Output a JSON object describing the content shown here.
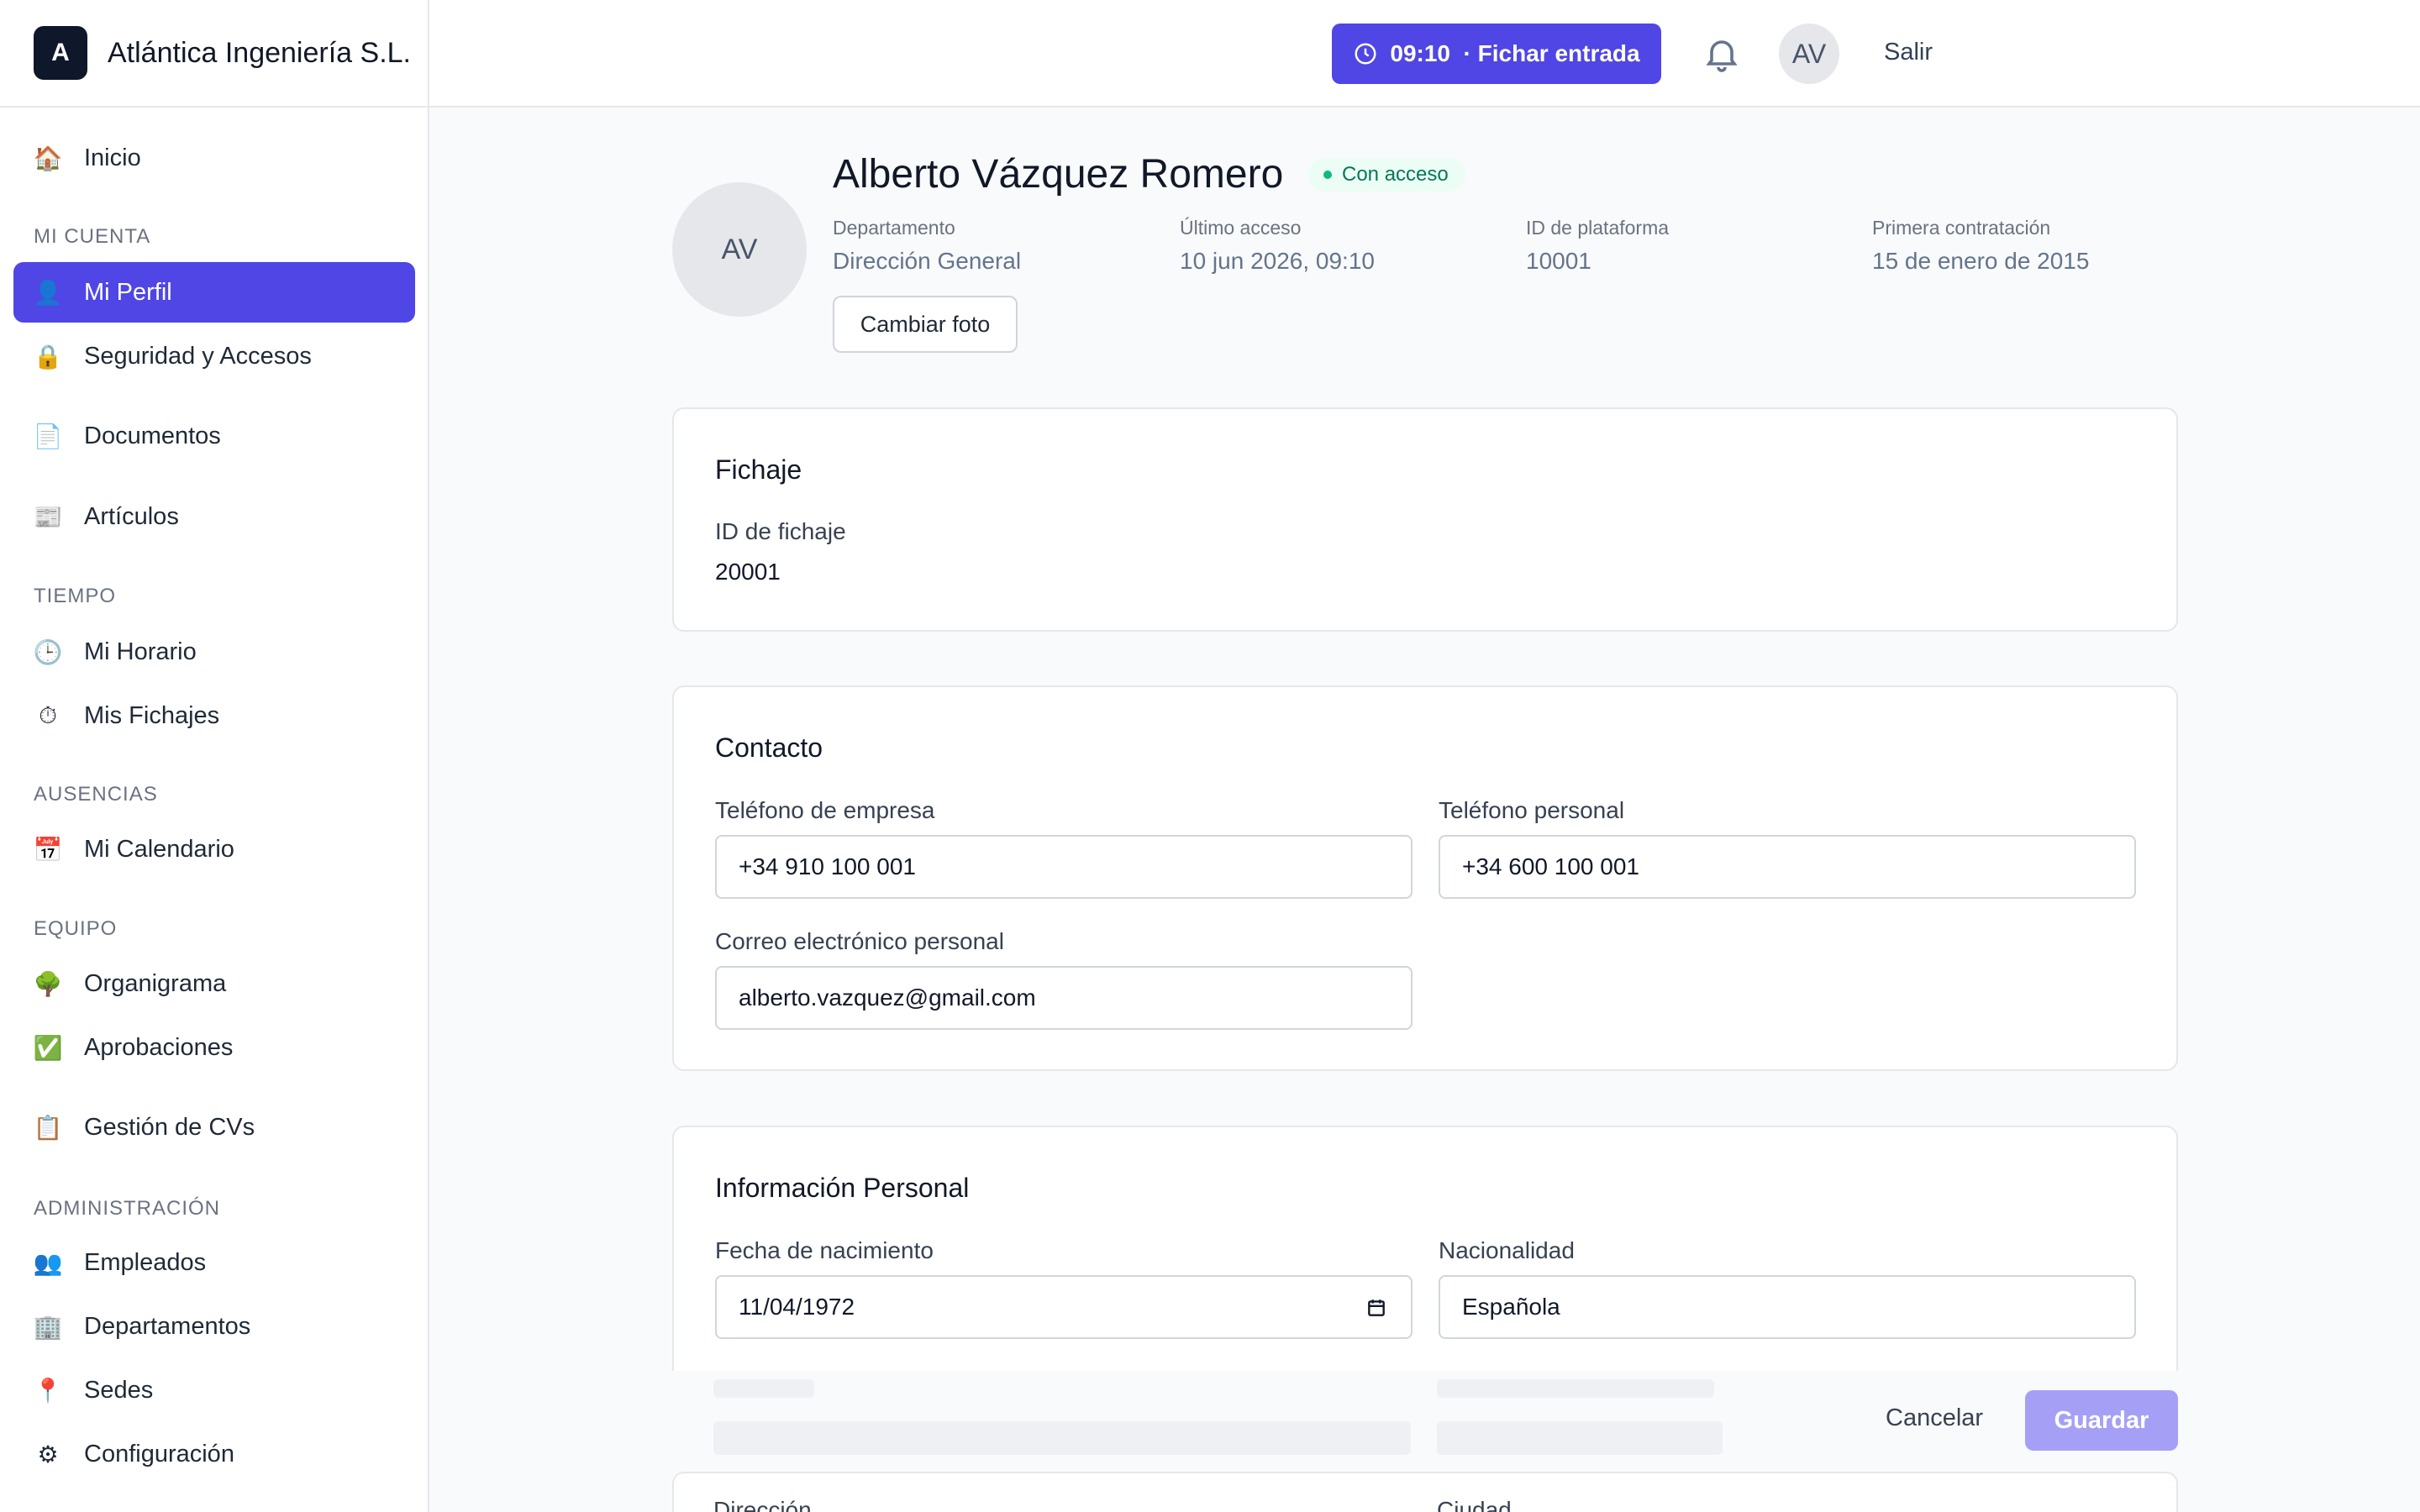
{
  "brand": {
    "logo_letter": "A",
    "name": "Atlántica Ingeniería S.L."
  },
  "topbar": {
    "clock_button": "09:10  · Fichar entrada",
    "avatar_initials": "AV",
    "logout": "Salir"
  },
  "sidebar": {
    "items": [
      {
        "label": "Inicio",
        "icon": "house-icon",
        "glyph": "🏠"
      },
      {
        "label": "Mi Perfil",
        "icon": "user-icon",
        "glyph": "👤",
        "active": true
      },
      {
        "label": "Seguridad y Accesos",
        "icon": "lock-icon",
        "glyph": "🔒"
      },
      {
        "label": "Documentos",
        "icon": "document-icon",
        "glyph": "📄"
      },
      {
        "label": "Artículos",
        "icon": "newspaper-icon",
        "glyph": "📰"
      },
      {
        "label": "Mi Horario",
        "icon": "clock-icon",
        "glyph": "🕒"
      },
      {
        "label": "Mis Fichajes",
        "icon": "stopwatch-icon",
        "glyph": "⏱"
      },
      {
        "label": "Mi Calendario",
        "icon": "calendar-icon",
        "glyph": "📅"
      },
      {
        "label": "Organigrama",
        "icon": "tree-icon",
        "glyph": "🌳"
      },
      {
        "label": "Aprobaciones",
        "icon": "check-icon",
        "glyph": "✅"
      },
      {
        "label": "Gestión de CVs",
        "icon": "clipboard-icon",
        "glyph": "📋"
      },
      {
        "label": "Empleados",
        "icon": "users-icon",
        "glyph": "👥"
      },
      {
        "label": "Departamentos",
        "icon": "building-icon",
        "glyph": "🏢"
      },
      {
        "label": "Sedes",
        "icon": "pin-icon",
        "glyph": "📍"
      },
      {
        "label": "Configuración",
        "icon": "gear-icon",
        "glyph": "⚙"
      }
    ],
    "sections": [
      "MI CUENTA",
      "TIEMPO",
      "AUSENCIAS",
      "EQUIPO",
      "ADMINISTRACIÓN"
    ]
  },
  "profile": {
    "avatar_initials": "AV",
    "name": "Alberto Vázquez Romero",
    "status": "Con acceso",
    "meta": [
      {
        "label": "Departamento",
        "value": "Dirección General"
      },
      {
        "label": "Último acceso",
        "value": "10 jun 2026, 09:10"
      },
      {
        "label": "ID de plataforma",
        "value": "10001"
      },
      {
        "label": "Primera contratación",
        "value": "15 de enero de 2015"
      }
    ],
    "change_photo": "Cambiar foto"
  },
  "fichaje": {
    "title": "Fichaje",
    "id_label": "ID de fichaje",
    "id_value": "20001"
  },
  "contacto": {
    "title": "Contacto",
    "company_phone_label": "Teléfono de empresa",
    "company_phone": "+34 910 100 001",
    "personal_phone_label": "Teléfono personal",
    "personal_phone": "+34 600 100 001",
    "email_label": "Correo electrónico personal",
    "email": "alberto.vazquez@gmail.com"
  },
  "personal": {
    "title": "Información Personal",
    "birth_label": "Fecha de nacimiento",
    "birth": "11/04/1972",
    "nationality_label": "Nacionalidad",
    "nationality": "Española",
    "address_label": "Dirección",
    "city_label": "Ciudad"
  },
  "actions": {
    "cancel": "Cancelar",
    "save": "Guardar"
  },
  "colors": {
    "accent": "#4f46e5",
    "accent_disabled": "#a5a0f5",
    "status_green": "#10b981"
  }
}
